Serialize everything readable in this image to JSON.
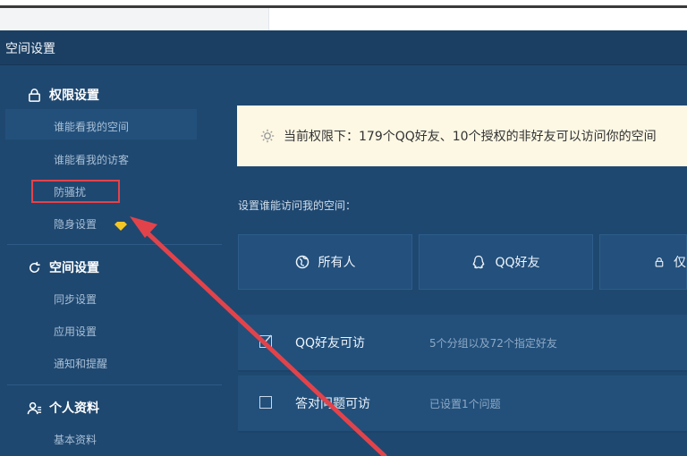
{
  "window": {
    "title": "空间设置"
  },
  "sidebar": {
    "sections": [
      {
        "title": "权限设置",
        "icon": "lock-icon",
        "items": [
          "谁能看我的空间",
          "谁能看我的访客",
          "防骚扰",
          "隐身设置"
        ]
      },
      {
        "title": "空间设置",
        "icon": "refresh-icon",
        "items": [
          "同步设置",
          "应用设置",
          "通知和提醒"
        ]
      },
      {
        "title": "个人资料",
        "icon": "person-icon",
        "items": [
          "基本资料"
        ]
      }
    ]
  },
  "main": {
    "notice": "当前权限下：179个QQ好友、10个授权的非好友可以访问你的空间",
    "access_label": "设置谁能访问我的空间：",
    "options": [
      {
        "label": "所有人",
        "icon": "globe-icon"
      },
      {
        "label": "QQ好友",
        "icon": "qq-icon"
      },
      {
        "label": "仅",
        "icon": "lock-icon"
      }
    ],
    "rows": [
      {
        "label": "QQ好友可访",
        "desc": "5个分组以及72个指定好友",
        "checked": true
      },
      {
        "label": "答对问题可访",
        "desc": "已设置1个问题",
        "checked": false
      }
    ]
  },
  "colors": {
    "accent": "#1f4870",
    "highlight": "#e2434b",
    "notice_bg": "#fdf8e4"
  }
}
